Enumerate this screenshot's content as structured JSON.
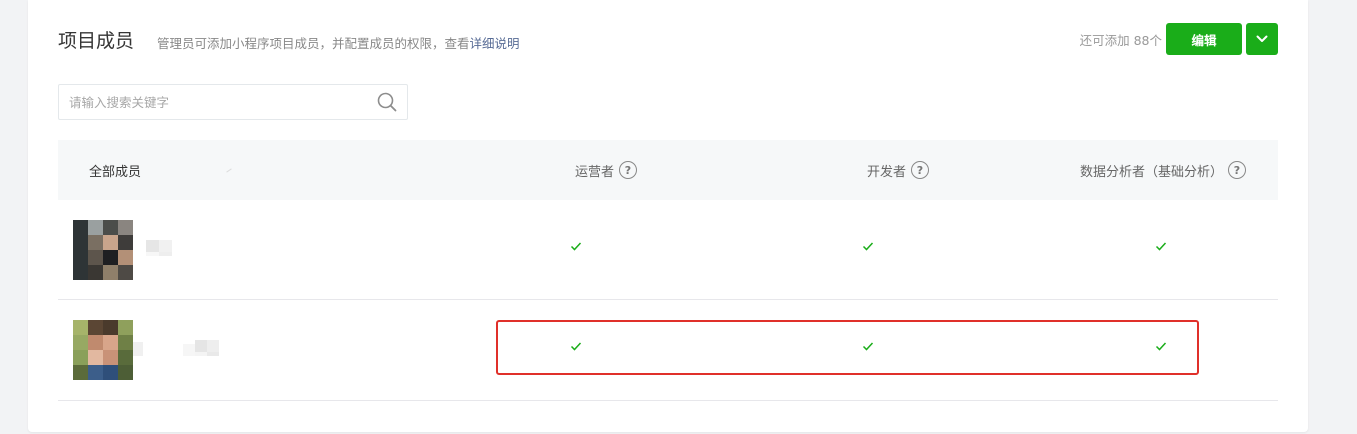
{
  "header": {
    "title": "项目成员",
    "description_prefix": "管理员可添加小程序项目成员，并配置成员的权限，查看",
    "description_link": "详细说明",
    "quota_text": "还可添加 88个",
    "edit_label": "编辑"
  },
  "search": {
    "placeholder": "请输入搜索关键字"
  },
  "table": {
    "columns": [
      "全部成员",
      "运营者",
      "开发者",
      "数据分析者（基础分析）"
    ],
    "help_mark": "?",
    "rows": [
      {
        "operator": true,
        "developer": true,
        "analyst": true
      },
      {
        "operator": true,
        "developer": true,
        "analyst": true
      }
    ]
  },
  "colors": {
    "brand_green": "#1aad19",
    "link": "#576b95",
    "highlight_border": "#e0302a"
  },
  "icons": [
    "search-icon",
    "chevron-down-icon",
    "help-icon",
    "check-icon"
  ]
}
